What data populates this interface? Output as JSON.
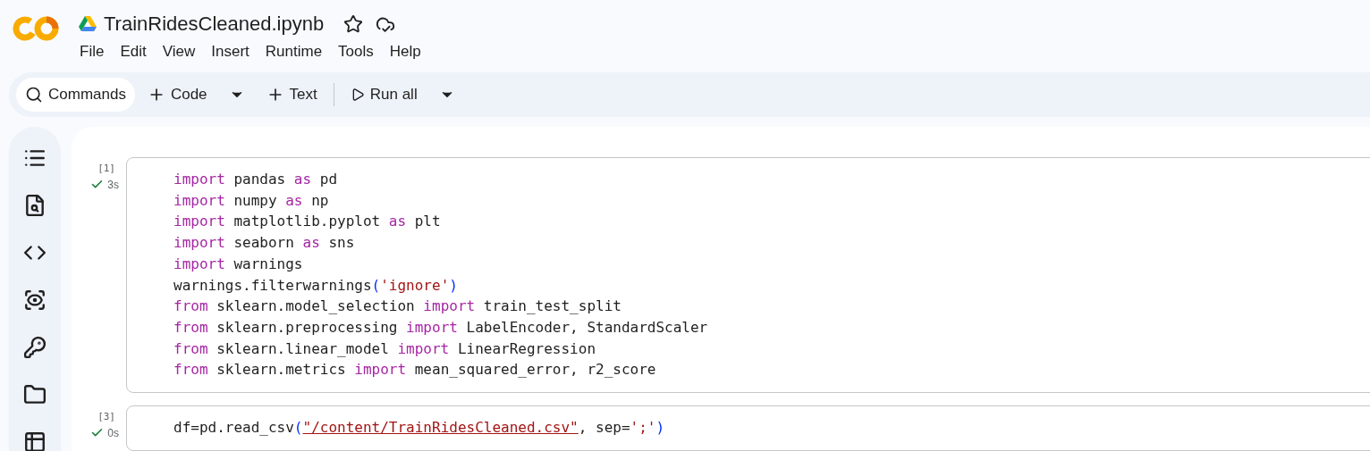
{
  "header": {
    "title": "TrainRidesCleaned.ipynb",
    "starred": false,
    "menu": [
      "File",
      "Edit",
      "View",
      "Insert",
      "Runtime",
      "Tools",
      "Help"
    ]
  },
  "toolbar": {
    "items": [
      {
        "kind": "search",
        "label": "Commands"
      },
      {
        "kind": "add",
        "label": "Code"
      },
      {
        "kind": "dropdown"
      },
      {
        "kind": "add",
        "label": "Text"
      },
      {
        "kind": "divider"
      },
      {
        "kind": "run",
        "label": "Run all"
      },
      {
        "kind": "dropdown"
      }
    ]
  },
  "cells": [
    {
      "count": "[1]",
      "done": true,
      "time": "3s",
      "lines": [
        [
          {
            "kind": "keyword",
            "text": "import"
          },
          {
            "kind": "plain",
            "text": " pandas "
          },
          {
            "kind": "keyword",
            "text": "as"
          },
          {
            "kind": "plain",
            "text": " pd"
          }
        ],
        [
          {
            "kind": "keyword",
            "text": "import"
          },
          {
            "kind": "plain",
            "text": " numpy "
          },
          {
            "kind": "keyword",
            "text": "as"
          },
          {
            "kind": "plain",
            "text": " np"
          }
        ],
        [
          {
            "kind": "keyword",
            "text": "import"
          },
          {
            "kind": "plain",
            "text": " matplotlib.pyplot "
          },
          {
            "kind": "keyword",
            "text": "as"
          },
          {
            "kind": "plain",
            "text": " plt"
          }
        ],
        [
          {
            "kind": "keyword",
            "text": "import"
          },
          {
            "kind": "plain",
            "text": " seaborn "
          },
          {
            "kind": "keyword",
            "text": "as"
          },
          {
            "kind": "plain",
            "text": " sns"
          }
        ],
        [
          {
            "kind": "keyword",
            "text": "import"
          },
          {
            "kind": "plain",
            "text": " warnings"
          }
        ],
        [
          {
            "kind": "plain",
            "text": "warnings.filterwarnings"
          },
          {
            "kind": "paren",
            "text": "("
          },
          {
            "kind": "string",
            "text": "'ignore'"
          },
          {
            "kind": "paren",
            "text": ")"
          }
        ],
        [
          {
            "kind": "keyword",
            "text": "from"
          },
          {
            "kind": "plain",
            "text": " sklearn.model_selection "
          },
          {
            "kind": "keyword",
            "text": "import"
          },
          {
            "kind": "plain",
            "text": " train_test_split"
          }
        ],
        [
          {
            "kind": "keyword",
            "text": "from"
          },
          {
            "kind": "plain",
            "text": " sklearn.preprocessing "
          },
          {
            "kind": "keyword",
            "text": "import"
          },
          {
            "kind": "plain",
            "text": " LabelEncoder, StandardScaler"
          }
        ],
        [
          {
            "kind": "keyword",
            "text": "from"
          },
          {
            "kind": "plain",
            "text": " sklearn.linear_model "
          },
          {
            "kind": "keyword",
            "text": "import"
          },
          {
            "kind": "plain",
            "text": " LinearRegression"
          }
        ],
        [
          {
            "kind": "keyword",
            "text": "from"
          },
          {
            "kind": "plain",
            "text": " sklearn.metrics "
          },
          {
            "kind": "keyword",
            "text": "import"
          },
          {
            "kind": "plain",
            "text": " mean_squared_error, r2_score"
          }
        ]
      ]
    },
    {
      "count": "[3]",
      "done": true,
      "time": "0s",
      "lines": [
        [
          {
            "kind": "plain",
            "text": "df=pd.read_csv"
          },
          {
            "kind": "paren",
            "text": "("
          },
          {
            "kind": "link",
            "text": "\"/content/TrainRidesCleaned.csv\""
          },
          {
            "kind": "plain",
            "text": ", sep="
          },
          {
            "kind": "string",
            "text": "';'"
          },
          {
            "kind": "paren",
            "text": ")"
          }
        ]
      ]
    }
  ]
}
